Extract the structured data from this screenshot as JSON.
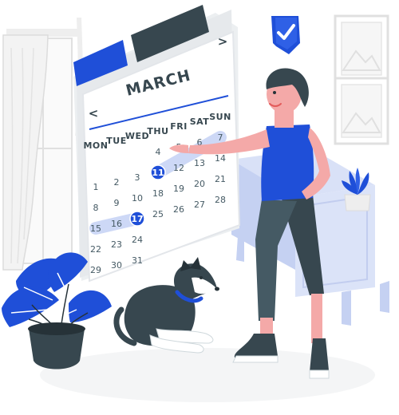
{
  "colors": {
    "accent": "#1f4fd8",
    "accent_light": "#cdd8f6",
    "outline": "#263238",
    "paper": "#ffffff",
    "paper_shade": "#e9ebee",
    "grey_light": "#eeeeee",
    "dark": "#37474f",
    "skin": "#f4a9a8"
  },
  "calendar": {
    "month": "MARCH",
    "prev_icon": "chevron-left-icon",
    "next_icon": "chevron-right-icon",
    "weekdays": [
      "MON",
      "TUE",
      "WED",
      "THU",
      "FRI",
      "SAT",
      "SUN"
    ],
    "weeks": [
      [
        "",
        "",
        "",
        "",
        "",
        "",
        "",
        ""
      ],
      [
        "",
        "",
        "",
        "4",
        "5",
        "6",
        "7"
      ],
      [
        "1",
        "2",
        "3",
        "11",
        "12",
        "13",
        "14"
      ],
      [
        "8",
        "9",
        "10",
        "18",
        "19",
        "20",
        "21"
      ],
      [
        "15",
        "16",
        "17",
        "25",
        "26",
        "27",
        "28"
      ],
      [
        "22",
        "23",
        "24",
        "",
        "",
        "",
        ""
      ],
      [
        "29",
        "30",
        "31",
        "",
        "",
        "",
        ""
      ]
    ],
    "selected_days": [
      "11",
      "17"
    ],
    "highlighted_range_rows": [
      2,
      4
    ]
  },
  "badge": {
    "icon": "checkmark-icon"
  },
  "wall_frames": [
    {
      "icon": "landscape-picture-icon"
    },
    {
      "icon": "landscape-picture-icon"
    }
  ],
  "scene": {
    "person": "woman-pointing",
    "dog": "dog-lying",
    "plant_left": "monstera-plant-pot",
    "plant_right": "small-plant-pot",
    "furniture": "sideboard-cabinet",
    "window": "window-with-curtain"
  }
}
